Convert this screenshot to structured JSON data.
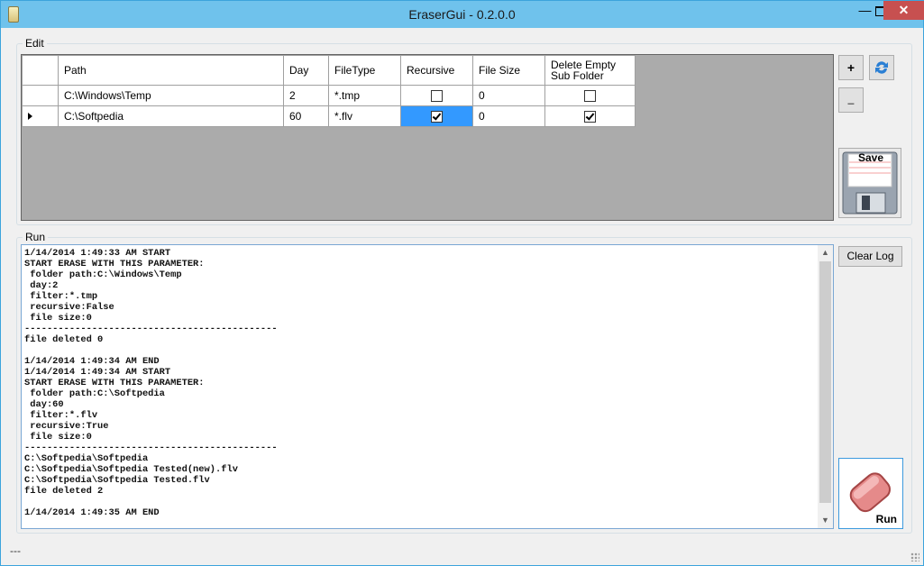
{
  "window": {
    "title": "EraserGui - 0.2.0.0",
    "min": "—",
    "close": "✕"
  },
  "edit": {
    "label": "Edit",
    "columns": [
      "Path",
      "Day",
      "FileType",
      "Recursive",
      "File Size",
      "Delete Empty Sub Folder"
    ],
    "rows": [
      {
        "path": "C:\\Windows\\Temp",
        "day": "2",
        "filetype": "*.tmp",
        "recursive": false,
        "filesize": "0",
        "delete_empty": false,
        "current": false
      },
      {
        "path": "C:\\Softpedia",
        "day": "60",
        "filetype": "*.flv",
        "recursive": true,
        "filesize": "0",
        "delete_empty": true,
        "current": true
      }
    ],
    "add_label": "+",
    "remove_label": "_",
    "save_label": "Save"
  },
  "run": {
    "label": "Run",
    "clear_log_label": "Clear Log",
    "run_label": "Run",
    "log": "1/14/2014 1:49:33 AM START\nSTART ERASE WITH THIS PARAMETER:\n folder path:C:\\Windows\\Temp\n day:2\n filter:*.tmp\n recursive:False\n file size:0\n---------------------------------------------\nfile deleted 0\n\n1/14/2014 1:49:34 AM END\n1/14/2014 1:49:34 AM START\nSTART ERASE WITH THIS PARAMETER:\n folder path:C:\\Softpedia\n day:60\n filter:*.flv\n recursive:True\n file size:0\n---------------------------------------------\nC:\\Softpedia\\Softpedia\nC:\\Softpedia\\Softpedia Tested(new).flv\nC:\\Softpedia\\Softpedia Tested.flv\nfile deleted 2\n\n1/14/2014 1:49:35 AM END"
  },
  "status": {
    "text": "---"
  }
}
